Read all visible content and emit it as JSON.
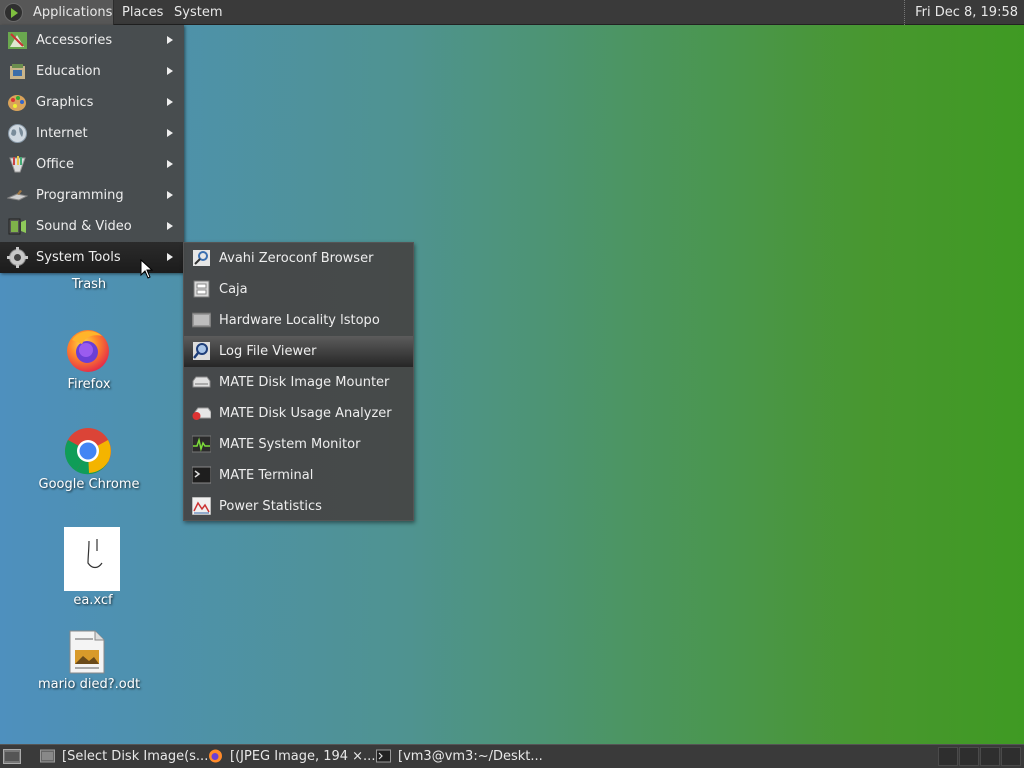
{
  "top_panel": {
    "applications_label": "Applications",
    "places_label": "Places",
    "system_label": "System",
    "clock": "Fri Dec  8, 19:58"
  },
  "apps_menu": {
    "items": [
      {
        "label": "Accessories",
        "icon": "accessories-icon"
      },
      {
        "label": "Education",
        "icon": "education-icon"
      },
      {
        "label": "Graphics",
        "icon": "graphics-icon"
      },
      {
        "label": "Internet",
        "icon": "internet-icon"
      },
      {
        "label": "Office",
        "icon": "office-icon"
      },
      {
        "label": "Programming",
        "icon": "programming-icon"
      },
      {
        "label": "Sound & Video",
        "icon": "sound-video-icon"
      },
      {
        "label": "System Tools",
        "icon": "system-tools-icon",
        "active": true
      }
    ]
  },
  "system_tools_menu": {
    "items": [
      {
        "label": "Avahi Zeroconf Browser",
        "icon": "avahi-icon"
      },
      {
        "label": "Caja",
        "icon": "caja-icon"
      },
      {
        "label": "Hardware Locality lstopo",
        "icon": "lstopo-icon"
      },
      {
        "label": "Log File Viewer",
        "icon": "log-viewer-icon",
        "hovered": true
      },
      {
        "label": "MATE Disk Image Mounter",
        "icon": "disk-mounter-icon"
      },
      {
        "label": "MATE Disk Usage Analyzer",
        "icon": "disk-usage-icon"
      },
      {
        "label": "MATE System Monitor",
        "icon": "system-monitor-icon"
      },
      {
        "label": "MATE Terminal",
        "icon": "terminal-icon"
      },
      {
        "label": "Power Statistics",
        "icon": "power-statistics-icon"
      }
    ]
  },
  "desktop": {
    "icons": [
      {
        "label": "Trash",
        "icon": "trash-icon"
      },
      {
        "label": "Firefox",
        "icon": "firefox-icon"
      },
      {
        "label": "Google Chrome",
        "icon": "chrome-icon"
      },
      {
        "label": "ea.xcf",
        "icon": "xcf-image-icon"
      },
      {
        "label": "mario died?.odt",
        "icon": "odt-document-icon"
      }
    ]
  },
  "taskbar": {
    "tasks": [
      {
        "label": "[Select Disk Image(s...",
        "icon": "disk-window-icon"
      },
      {
        "label": "[(JPEG Image, 194 ×...",
        "icon": "firefox-icon"
      },
      {
        "label": "[vm3@vm3:~/Deskt...",
        "icon": "terminal-icon"
      }
    ]
  },
  "colors": {
    "panel": "#3a3a3a",
    "menu_bg": "#484848",
    "desktop_left": "#4e90be",
    "desktop_right": "#3f9a23"
  }
}
